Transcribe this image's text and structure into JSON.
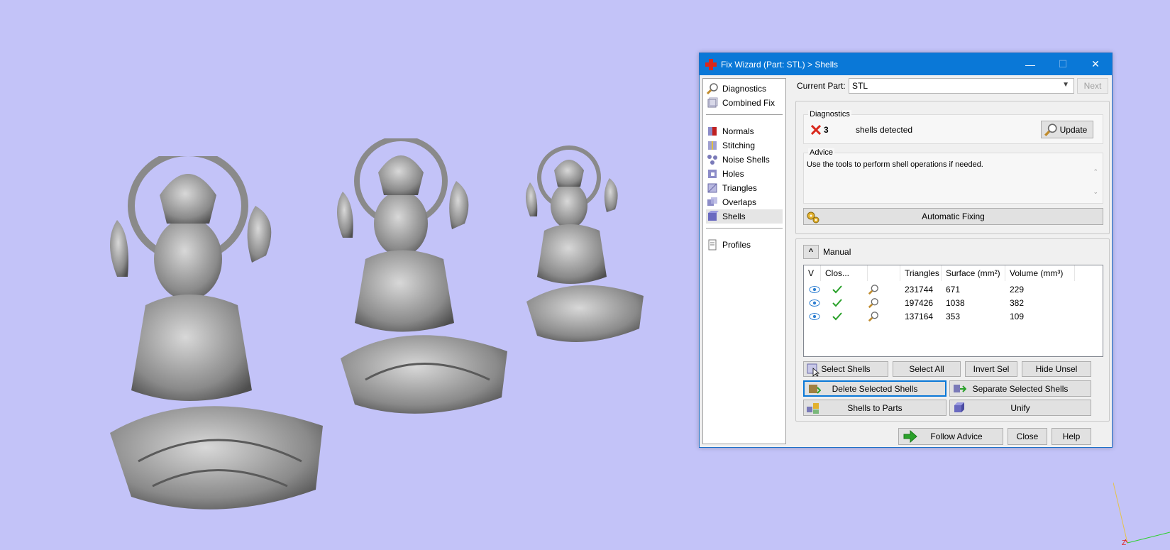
{
  "window": {
    "title": "Fix Wizard (Part: STL) > Shells",
    "minimize_glyph": "—",
    "maximize_glyph": "☐",
    "close_glyph": "✕"
  },
  "nav": {
    "items": [
      {
        "label": "Diagnostics",
        "icon": "magnifier-icon"
      },
      {
        "label": "Combined Fix",
        "icon": "combined-fix-icon"
      },
      {
        "label": "Normals",
        "icon": "normals-icon"
      },
      {
        "label": "Stitching",
        "icon": "stitching-icon"
      },
      {
        "label": "Noise Shells",
        "icon": "noise-shells-icon"
      },
      {
        "label": "Holes",
        "icon": "holes-icon"
      },
      {
        "label": "Triangles",
        "icon": "triangles-icon"
      },
      {
        "label": "Overlaps",
        "icon": "overlaps-icon"
      },
      {
        "label": "Shells",
        "icon": "shells-icon",
        "selected": true
      },
      {
        "label": "Profiles",
        "icon": "profiles-icon"
      }
    ]
  },
  "current_part": {
    "label": "Current Part:",
    "value": "STL",
    "next_label": "Next"
  },
  "diagnostics": {
    "title": "Diagnostics",
    "count": "3",
    "text": "shells detected",
    "update_label": "Update"
  },
  "advice": {
    "title": "Advice",
    "text": "Use the tools to perform shell operations if needed.",
    "automatic_fixing_label": "Automatic Fixing"
  },
  "manual": {
    "label": "Manual",
    "columns": [
      "V",
      "Clos...",
      "",
      "Triangles",
      "Surface (mm²)",
      "Volume (mm³)"
    ],
    "rows": [
      {
        "triangles": "231744",
        "surface": "671",
        "volume": "229"
      },
      {
        "triangles": "197426",
        "surface": "1038",
        "volume": "382"
      },
      {
        "triangles": "137164",
        "surface": "353",
        "volume": "109"
      }
    ],
    "buttons": {
      "select_shells": "Select Shells",
      "select_all": "Select All",
      "invert_sel": "Invert Sel",
      "hide_unsel": "Hide Unsel",
      "delete_selected": "Delete Selected Shells",
      "separate_selected": "Separate Selected Shells",
      "shells_to_parts": "Shells to Parts",
      "unify": "Unify"
    }
  },
  "footer": {
    "follow_advice": "Follow Advice",
    "close": "Close",
    "help": "Help"
  },
  "colors": {
    "viewport_bg": "#c3c3f8",
    "titlebar": "#0a78d7",
    "error_x": "#d9281c",
    "check": "#2aa12a"
  }
}
